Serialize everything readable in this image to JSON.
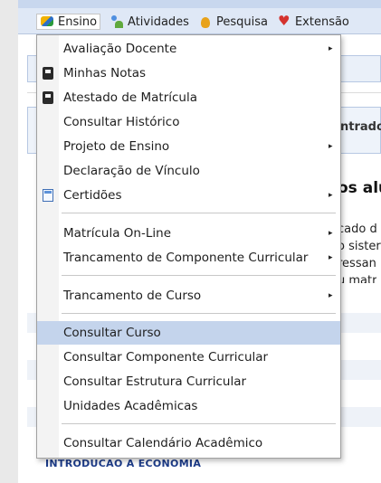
{
  "menubar": {
    "items": [
      {
        "label": "Ensino",
        "icon": "book-icon"
      },
      {
        "label": "Atividades",
        "icon": "people-icon"
      },
      {
        "label": "Pesquisa",
        "icon": "flask-icon"
      },
      {
        "label": "Extensão",
        "icon": "heart-icon"
      }
    ]
  },
  "background": {
    "partial_label": "ntrado",
    "heading_fragment": "os alu",
    "text_fragments": [
      "cado d",
      "o sister",
      "ressan",
      "u matr"
    ],
    "course_link": "INTRODUCAO A ECONOMIA"
  },
  "dropdown": {
    "items": [
      {
        "label": "Avaliação Docente",
        "submenu": true
      },
      {
        "label": "Minhas Notas",
        "icon": "phone-icon"
      },
      {
        "label": "Atestado de Matrícula",
        "icon": "phone-icon"
      },
      {
        "label": "Consultar Histórico"
      },
      {
        "label": "Projeto de Ensino",
        "submenu": true
      },
      {
        "label": "Declaração de Vínculo"
      },
      {
        "label": "Certidões",
        "icon": "certificate-icon",
        "submenu": true
      },
      {
        "label": "Matrícula On-Line",
        "submenu": true
      },
      {
        "label": "Trancamento de Componente Curricular",
        "submenu": true
      },
      {
        "label": "Trancamento de Curso",
        "submenu": true
      },
      {
        "label": "Consultar Curso",
        "selected": true
      },
      {
        "label": "Consultar Componente Curricular"
      },
      {
        "label": "Consultar Estrutura Curricular"
      },
      {
        "label": "Unidades Acadêmicas"
      },
      {
        "label": "Consultar Calendário Acadêmico"
      }
    ],
    "arrow_glyph": "▸"
  },
  "colors": {
    "menubar_bg": "#dfe8f6",
    "selected_bg": "#c4d4ec",
    "link_color": "#1d3c8a"
  }
}
